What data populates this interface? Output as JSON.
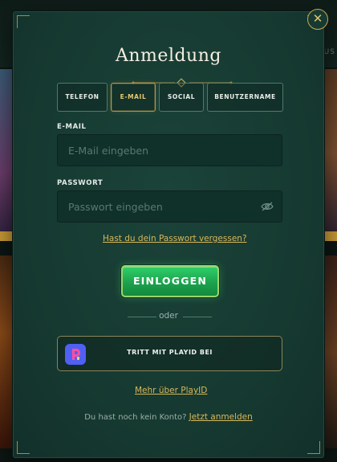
{
  "modal": {
    "title": "Anmeldung",
    "close_symbol": "✕"
  },
  "tabs": [
    {
      "label": "TELEFON",
      "active": false
    },
    {
      "label": "E-MAIL",
      "active": true
    },
    {
      "label": "SOCIAL",
      "active": false
    },
    {
      "label": "BENUTZERNAME",
      "active": false
    }
  ],
  "form": {
    "email_label": "E-MAIL",
    "email_placeholder": "E-Mail eingeben",
    "password_label": "PASSWORT",
    "password_placeholder": "Passwort eingeben",
    "password_toggle_icon": "eye-off-icon",
    "forgot_password": "Hast du dein Passwort vergessen?",
    "login_button": "EINLOGGEN"
  },
  "divider": {
    "text": "oder"
  },
  "playid": {
    "button_label": "TRITT MIT PLAYID BEI",
    "icon": "playid-logo-icon",
    "more_link": "Mehr über PlayID"
  },
  "footer": {
    "prompt": "Du hast noch kein Konto?",
    "register_link": "Jetzt anmelden"
  },
  "background": {
    "partial_text": "NUS"
  },
  "colors": {
    "modal_bg": "#163a31",
    "gold_accent": "#c9a64f",
    "login_green": "#1ca24e",
    "link_gold": "#d9b659"
  }
}
